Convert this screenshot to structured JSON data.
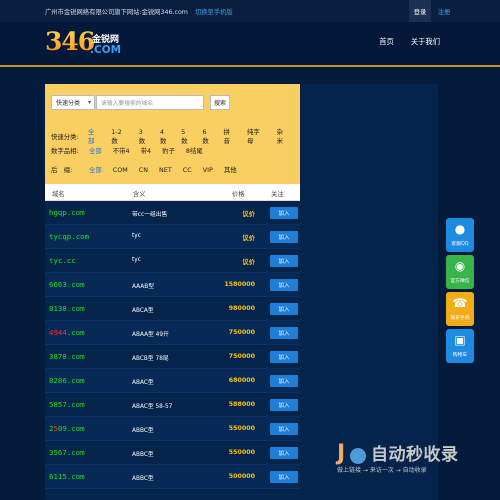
{
  "topbar": {
    "company_text": "广州市金锐网络有限公司旗下网站:金锐网346.com",
    "mobile_link": "切换至手机版",
    "login": "登录",
    "register": "注册"
  },
  "header": {
    "logo_number": "346",
    "logo_cn": "金锐网",
    "logo_com": ".COM",
    "nav": [
      "首页",
      "关于我们"
    ]
  },
  "filter": {
    "select_value": "快速分类",
    "search_placeholder": "请输入要搜索的域名",
    "search_button": "搜索",
    "rows": [
      {
        "label": "快速分类:",
        "options": [
          "全部",
          "1-2数",
          "3数",
          "4数",
          "5数",
          "6数",
          "拼音",
          "纯字母",
          "杂米"
        ]
      },
      {
        "label": "数字品相:",
        "options": [
          "全部",
          "不带4",
          "带4",
          "豹子",
          "8结尾"
        ]
      },
      {
        "label": "后　缀:",
        "options": [
          "全部",
          "COM",
          "CN",
          "NET",
          "CC",
          "VIP",
          "其他"
        ]
      }
    ]
  },
  "table": {
    "headers": {
      "domain": "域名",
      "meaning": "含义",
      "price": "价格",
      "focus": "关注"
    },
    "add_label": "加入",
    "rows": [
      {
        "domain_pre": "hgqp.com",
        "domain_hl": "",
        "domain_post": "",
        "meaning": "带cc一组出售",
        "price": "议价"
      },
      {
        "domain_pre": "tycqp.com",
        "domain_hl": "",
        "domain_post": "",
        "meaning": "tyc",
        "price": "议价"
      },
      {
        "domain_pre": "tyc.cc",
        "domain_hl": "",
        "domain_post": "",
        "meaning": "tyc",
        "price": "议价"
      },
      {
        "domain_pre": "666",
        "domain_hl": "",
        "domain_post": "3.com",
        "meaning": "AAAB型",
        "price": "1580000"
      },
      {
        "domain_pre": "8138.com",
        "domain_hl": "",
        "domain_post": "",
        "meaning": "ABCA型",
        "price": "980000"
      },
      {
        "domain_pre": "",
        "domain_hl": "4944",
        "domain_post": ".com",
        "meaning": "ABAA型 49开",
        "price": "750000"
      },
      {
        "domain_pre": "3878.com",
        "domain_hl": "",
        "domain_post": "",
        "meaning": "ABCB型 78尾",
        "price": "750000"
      },
      {
        "domain_pre": "8286.com",
        "domain_hl": "",
        "domain_post": "",
        "meaning": "ABAC型",
        "price": "680000"
      },
      {
        "domain_pre": "5857.com",
        "domain_hl": "",
        "domain_post": "",
        "meaning": "ABAC型 58-57",
        "price": "588000"
      },
      {
        "domain_pre": "2",
        "domain_hl": "5",
        "domain_post": "09.com",
        "meaning": "ABBC型",
        "price": "550000"
      },
      {
        "domain_pre": "3567.com",
        "domain_hl": "",
        "domain_post": "",
        "meaning": "ABBC型",
        "price": "550000"
      },
      {
        "domain_pre": "6115.com",
        "domain_hl": "",
        "domain_post": "",
        "meaning": "ABBC型",
        "price": "500000"
      }
    ]
  },
  "sidebar": [
    {
      "icon": "qq-icon",
      "label": "客服QQ",
      "color": "#1d8be0"
    },
    {
      "icon": "wechat-icon",
      "label": "官方微信",
      "color": "#38b44a"
    },
    {
      "icon": "phone-icon",
      "label": "联系手机",
      "color": "#f2ac18"
    },
    {
      "icon": "cart-icon",
      "label": "购物车",
      "color": "#1d8be0"
    }
  ],
  "watermark": {
    "title": "自动秒收录",
    "subtitle": "做上链接 → 来访一次 → 自动收录"
  },
  "colors": {
    "background": "#041b3b",
    "filter_bg": "#f9cf62",
    "domain_green": "#19e619",
    "price_gold": "#f6c21c",
    "button_blue": "#1f7fd6",
    "accent_line": "#c79a16"
  }
}
